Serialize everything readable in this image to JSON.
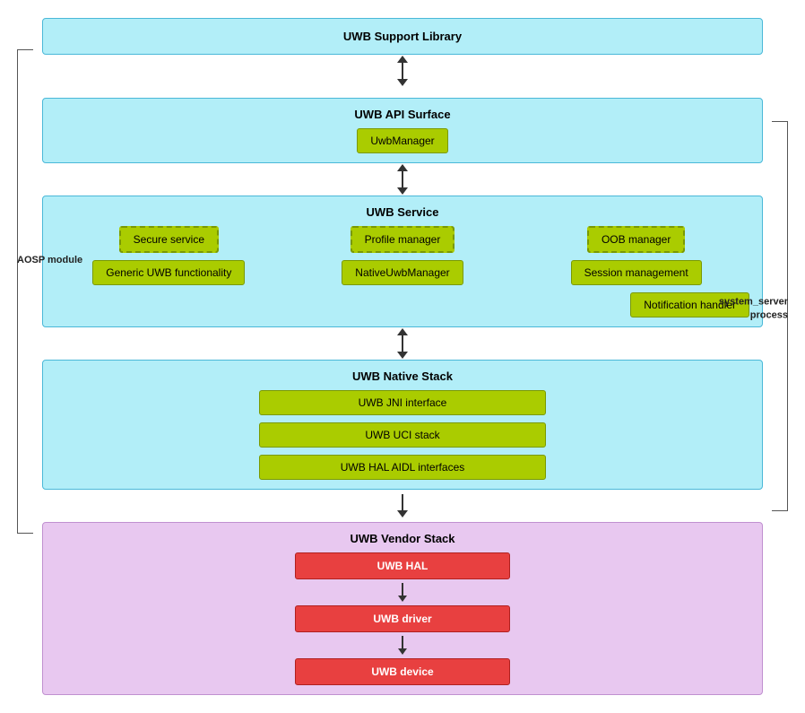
{
  "diagram": {
    "aosp_label": "AOSP module",
    "system_label_line1": "system_server",
    "system_label_line2": "process",
    "support_library": "UWB Support Library",
    "api_surface": {
      "title": "UWB API Surface",
      "inner": "UwbManager"
    },
    "uwb_service": {
      "title": "UWB Service",
      "row1": [
        "Secure service",
        "Profile manager",
        "OOB manager"
      ],
      "row2": [
        "Generic UWB functionality",
        "NativeUwbManager",
        "Session management"
      ],
      "row3": "Notification handler"
    },
    "native_stack": {
      "title": "UWB Native Stack",
      "items": [
        "UWB JNI interface",
        "UWB UCI stack",
        "UWB HAL AIDL interfaces"
      ]
    },
    "vendor_stack": {
      "title": "UWB Vendor Stack",
      "items": [
        "UWB HAL",
        "UWB driver",
        "UWB device"
      ]
    }
  }
}
